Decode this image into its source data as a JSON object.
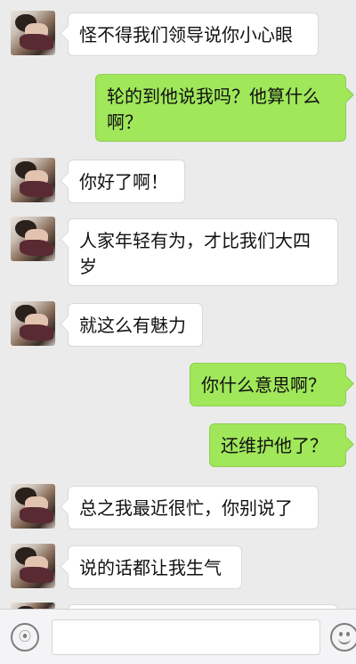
{
  "messages": [
    {
      "side": "left",
      "text": "怪不得我们领导说你小心眼"
    },
    {
      "side": "right",
      "text": "轮的到他说我吗？他算什么啊？"
    },
    {
      "side": "left",
      "text": "你好了啊！"
    },
    {
      "side": "left",
      "text": "人家年轻有为，才比我们大四岁"
    },
    {
      "side": "left",
      "text": "就这么有魅力"
    },
    {
      "side": "right",
      "text": "你什么意思啊？"
    },
    {
      "side": "right",
      "text": "还维护他了？"
    },
    {
      "side": "left",
      "text": "总之我最近很忙，你别说了"
    },
    {
      "side": "left",
      "text": "说的话都让我生气"
    }
  ],
  "icons": {
    "avatar": "contact-avatar",
    "voice": "voice-icon",
    "emoji": "emoji-icon"
  },
  "colors": {
    "background": "#ebebeb",
    "incoming_bubble": "#ffffff",
    "outgoing_bubble": "#a0e75a"
  }
}
